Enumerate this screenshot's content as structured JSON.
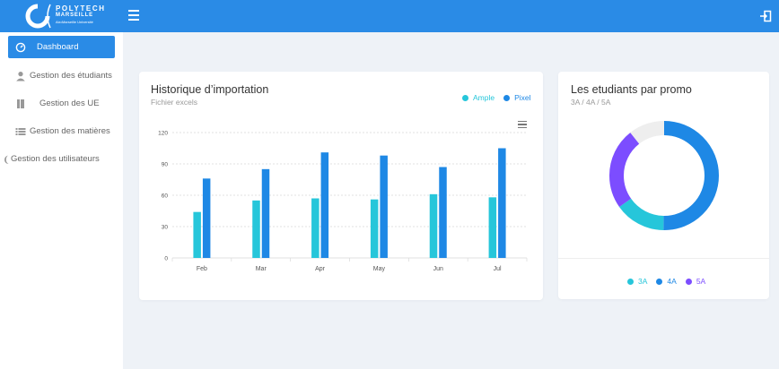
{
  "brand": {
    "name": "POLYTECH",
    "sub": "MARSEILLE",
    "university": "Aix•Marseille Université"
  },
  "sidebar": {
    "items": [
      {
        "label": "Dashboard",
        "icon": "dashboard-icon",
        "active": true
      },
      {
        "label": "Gestion des étudiants",
        "icon": "user-icon",
        "active": false
      },
      {
        "label": "Gestion des UE",
        "icon": "book-icon",
        "active": false
      },
      {
        "label": "Gestion des matières",
        "icon": "list-icon",
        "active": false
      },
      {
        "label": "Gestion des utilisateurs",
        "icon": "users-icon",
        "active": false
      }
    ]
  },
  "import_card": {
    "title": "Historique d’importation",
    "subtitle": "Fichier excels"
  },
  "promo_card": {
    "title": "Les etudiants par promo",
    "subtitle": "3A / 4A / 5A"
  },
  "colors": {
    "primary": "#2a8be6",
    "ample": "#26c6da",
    "pixel": "#1e88e5",
    "p3a": "#26c6da",
    "p4a": "#1e88e5",
    "p5a": "#7c4dff",
    "track": "#eeeeee"
  },
  "chart_data": [
    {
      "type": "bar",
      "categories": [
        "Feb",
        "Mar",
        "Apr",
        "May",
        "Jun",
        "Jul"
      ],
      "series": [
        {
          "name": "Ample",
          "values": [
            44,
            55,
            57,
            56,
            61,
            58
          ]
        },
        {
          "name": "Pixel",
          "values": [
            76,
            85,
            101,
            98,
            87,
            105
          ]
        }
      ],
      "yticks": [
        0,
        30,
        60,
        90,
        120
      ],
      "ylim": [
        0,
        120
      ],
      "grid": true,
      "legend": "top-right"
    },
    {
      "type": "pie",
      "donut": true,
      "labels": [
        "3A",
        "4A",
        "5A"
      ],
      "values": [
        15,
        50,
        24
      ],
      "legend": "bottom"
    }
  ]
}
